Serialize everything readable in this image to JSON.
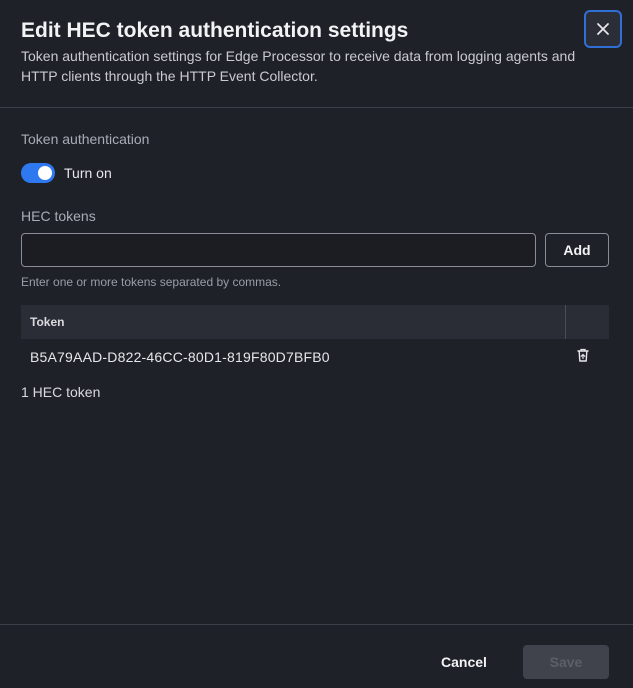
{
  "dialog": {
    "title": "Edit HEC token authentication settings",
    "subtitle": "Token authentication settings for Edge Processor to receive data from logging agents and HTTP clients through the HTTP Event Collector.",
    "close_icon": "close-icon"
  },
  "token_auth": {
    "label": "Token authentication",
    "toggle_label": "Turn on",
    "enabled": true
  },
  "hec_tokens": {
    "label": "HEC tokens",
    "input_value": "",
    "input_placeholder": "",
    "add_label": "Add",
    "helper": "Enter one or more tokens separated by commas."
  },
  "table": {
    "header_token": "Token",
    "rows": [
      {
        "token": "B5A79AAD-D822-46CC-80D1-819F80D7BFB0",
        "action_icon": "trash-icon"
      }
    ]
  },
  "count_text": "1 HEC token",
  "footer": {
    "cancel_label": "Cancel",
    "save_label": "Save"
  },
  "colors": {
    "accent": "#2f79f0",
    "focus_ring": "#2f6fd6",
    "background": "#1f2128"
  }
}
